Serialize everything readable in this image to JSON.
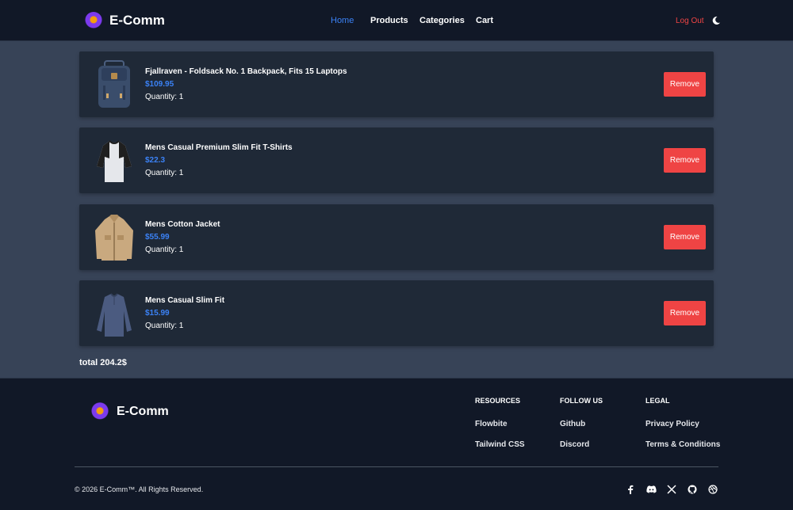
{
  "header": {
    "brand_name": "E-Comm",
    "nav": [
      "Home",
      "Products",
      "Categories",
      "Cart"
    ],
    "logout_label": "Log Out"
  },
  "cart": {
    "items": [
      {
        "title": "Fjallraven - Foldsack No. 1 Backpack, Fits 15 Laptops",
        "price": "$109.95",
        "quantity": "Quantity: 1",
        "remove_label": "Remove",
        "image_icon": "backpack-image"
      },
      {
        "title": "Mens Casual Premium Slim Fit T-Shirts",
        "price": "$22.3",
        "quantity": "Quantity: 1",
        "remove_label": "Remove",
        "image_icon": "tshirt-image"
      },
      {
        "title": "Mens Cotton Jacket",
        "price": "$55.99",
        "quantity": "Quantity: 1",
        "remove_label": "Remove",
        "image_icon": "jacket-image"
      },
      {
        "title": "Mens Casual Slim Fit",
        "price": "$15.99",
        "quantity": "Quantity: 1",
        "remove_label": "Remove",
        "image_icon": "longsleeve-image"
      }
    ],
    "total": "total 204.2$"
  },
  "footer": {
    "brand_name": "E-Comm",
    "columns": [
      {
        "heading": "RESOURCES",
        "links": [
          "Flowbite",
          "Tailwind CSS"
        ]
      },
      {
        "heading": "FOLLOW US",
        "links": [
          "Github",
          "Discord"
        ]
      },
      {
        "heading": "LEGAL",
        "links": [
          "Privacy Policy",
          "Terms & Conditions"
        ]
      }
    ],
    "copyright": "© 2026 E-Comm™. All Rights Reserved.",
    "social_icons": [
      "facebook-icon",
      "discord-icon",
      "x-icon",
      "github-icon",
      "dribbble-icon"
    ]
  },
  "colors": {
    "header_bg": "#111827",
    "page_bg": "#374357",
    "card_bg": "#1f2937",
    "accent": "#3b82f6",
    "danger": "#ef4444"
  }
}
